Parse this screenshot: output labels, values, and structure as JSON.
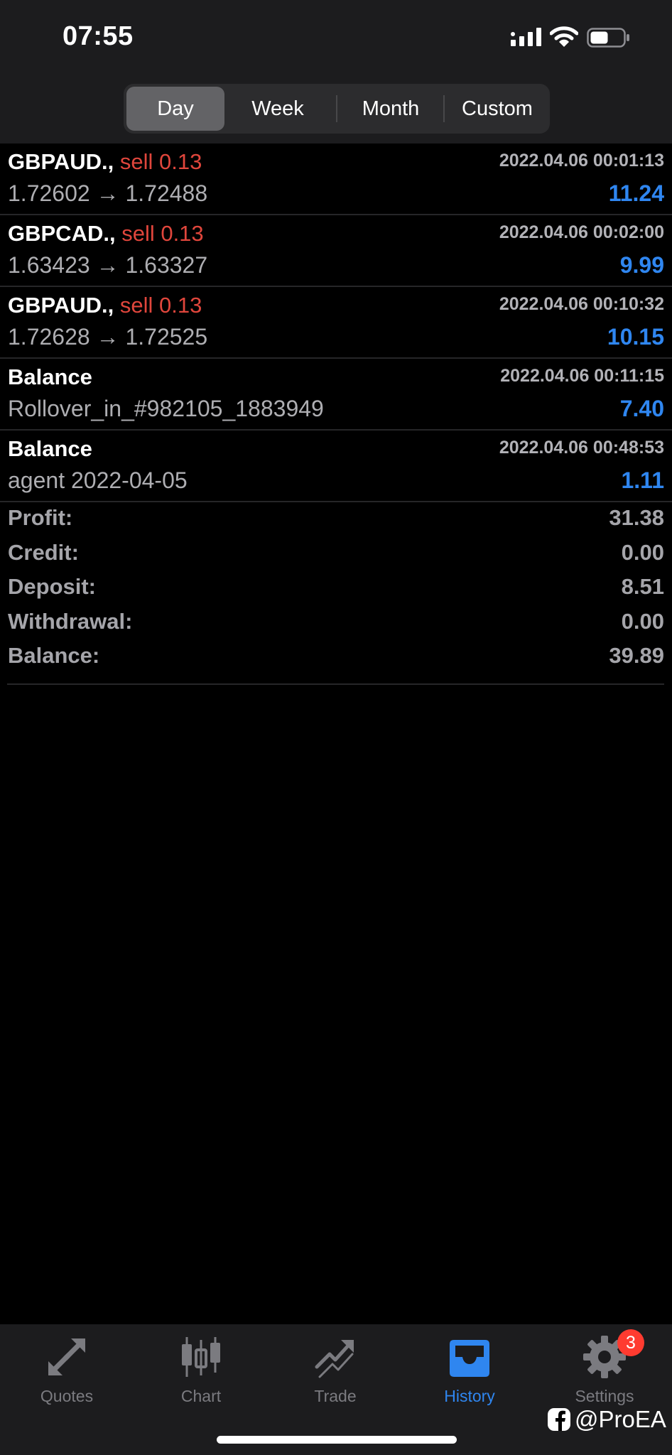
{
  "status_bar": {
    "time": "07:55"
  },
  "period_tabs": {
    "day": "Day",
    "week": "Week",
    "month": "Month",
    "custom": "Custom",
    "selected": "Day"
  },
  "deals": [
    {
      "title": "GBPAUD.,",
      "side": "sell 0.13",
      "time": "2022.04.06 00:01:13",
      "description": "1.72602 → 1.72488",
      "profit": "11.24"
    },
    {
      "title": "GBPCAD.,",
      "side": "sell 0.13",
      "time": "2022.04.06 00:02:00",
      "description": "1.63423 → 1.63327",
      "profit": "9.99"
    },
    {
      "title": "GBPAUD.,",
      "side": "sell 0.13",
      "time": "2022.04.06 00:10:32",
      "description": "1.72628 → 1.72525",
      "profit": "10.15"
    },
    {
      "title": "Balance",
      "side": "",
      "time": "2022.04.06 00:11:15",
      "description": "Rollover_in_#982105_1883949",
      "profit": "7.40"
    },
    {
      "title": "Balance",
      "side": "",
      "time": "2022.04.06 00:48:53",
      "description": "agent 2022-04-05",
      "profit": "1.11"
    }
  ],
  "summary": {
    "profit_label": "Profit:",
    "profit_value": "31.38",
    "credit_label": "Credit:",
    "credit_value": "0.00",
    "deposit_label": "Deposit:",
    "deposit_value": "8.51",
    "withdrawal_label": "Withdrawal:",
    "withdrawal_value": "0.00",
    "balance_label": "Balance:",
    "balance_value": "39.89"
  },
  "tab_bar": {
    "quotes": "Quotes",
    "chart": "Chart",
    "trade": "Trade",
    "history": "History",
    "settings": "Settings",
    "active": "History",
    "settings_badge": "3"
  },
  "watermark": "@ProEA",
  "colors": {
    "background": "#000000",
    "header": "#1c1c1e",
    "sell": "#e0463c",
    "profit": "#2f86f0",
    "active_tab": "#2f86f0",
    "inactive_tab": "#7b7b80",
    "badge": "#ff3b30"
  },
  "icons": {
    "signal": "cellular-signal-icon",
    "wifi": "wifi-icon",
    "battery": "battery-icon",
    "quotes": "quotes-arrows-icon",
    "chart": "candlestick-chart-icon",
    "trade": "trade-trend-icon",
    "history": "history-inbox-icon",
    "settings": "gear-icon",
    "watermark": "facebook-icon"
  }
}
